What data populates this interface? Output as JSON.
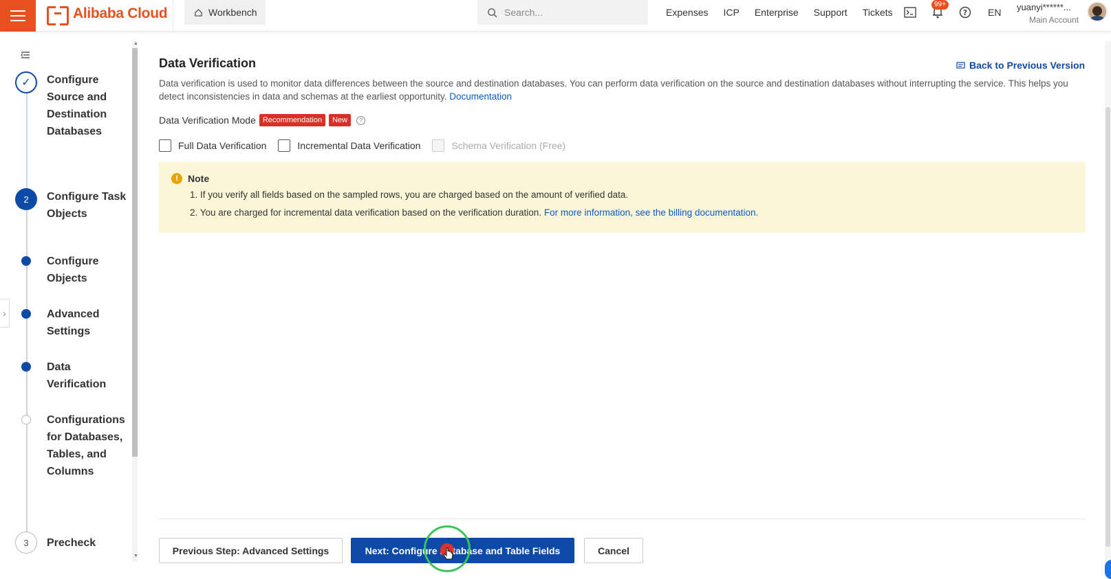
{
  "topbar": {
    "brand": "Alibaba Cloud",
    "workbench": "Workbench",
    "search_placeholder": "Search...",
    "nav": [
      "Expenses",
      "ICP",
      "Enterprise",
      "Support",
      "Tickets"
    ],
    "notification_badge": "99+",
    "language": "EN",
    "user": "yuanyi******...",
    "account_type": "Main Account",
    "accent_color": "#e8501d"
  },
  "steps": [
    {
      "state": "done",
      "label": "Configure Source and Destination Databases"
    },
    {
      "state": "active",
      "number": "2",
      "label": "Configure Task Objects"
    },
    {
      "state": "substep-done",
      "label": "Configure Objects"
    },
    {
      "state": "substep-done",
      "label": "Advanced Settings"
    },
    {
      "state": "substep-current",
      "label": "Data Verification"
    },
    {
      "state": "substep-todo",
      "label": "Configurations for Databases, Tables, and Columns"
    },
    {
      "state": "todo",
      "number": "3",
      "label": "Precheck"
    }
  ],
  "main": {
    "title": "Data Verification",
    "back_link": "Back to Previous Version",
    "description": "Data verification is used to monitor data differences between the source and destination databases. You can perform data verification on the source and destination databases without interrupting the service. This helps you detect inconsistencies in data and schemas at the earliest opportunity.",
    "doc_link": "Documentation",
    "mode_label": "Data Verification Mode",
    "tag_recommendation": "Recommendation",
    "tag_new": "New",
    "options": [
      {
        "label": "Full Data Verification",
        "checked": false,
        "disabled": false
      },
      {
        "label": "Incremental Data Verification",
        "checked": false,
        "disabled": false
      },
      {
        "label": "Schema Verification (Free)",
        "checked": false,
        "disabled": true
      }
    ],
    "note": {
      "title": "Note",
      "line1": "1. If you verify all fields based on the sampled rows, you are charged based on the amount of verified data.",
      "line2": "2. You are charged for incremental data verification based on the verification duration.",
      "line2_link": "For more information, see the billing documentation."
    }
  },
  "footer": {
    "prev": "Previous Step: Advanced Settings",
    "next": "Next: Configure Database and Table Fields",
    "cancel": "Cancel"
  },
  "colors": {
    "primary": "#0d4aa8",
    "tag_red": "#d93026",
    "note_bg": "#fbf6d7"
  }
}
